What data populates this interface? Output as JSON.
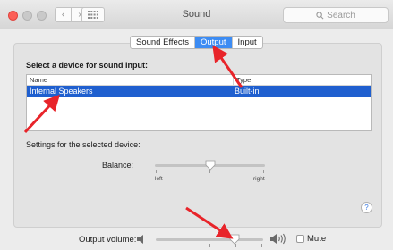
{
  "window": {
    "title": "Sound"
  },
  "toolbar": {
    "back_icon": "chevron-left-icon",
    "forward_icon": "chevron-right-icon",
    "grid_icon": "grid-icon",
    "search_placeholder": "Search",
    "search_icon": "search-icon"
  },
  "tabs": [
    {
      "label": "Sound Effects",
      "active": false
    },
    {
      "label": "Output",
      "active": true
    },
    {
      "label": "Input",
      "active": false
    }
  ],
  "device_section": {
    "title": "Select a device for sound input:",
    "columns": [
      "Name",
      "Type"
    ],
    "rows": [
      {
        "name": "Internal Speakers",
        "type": "Built-in",
        "selected": true
      }
    ]
  },
  "settings": {
    "title": "Settings for the selected device:",
    "balance_label": "Balance:",
    "balance_left": "left",
    "balance_right": "right",
    "balance_value": 0.5
  },
  "help": {
    "label": "?"
  },
  "volume": {
    "label": "Output volume:",
    "value": 0.73,
    "mute_label": "Mute",
    "muted": false
  },
  "colors": {
    "accent": "#3d8cf3",
    "selection": "#1f5fcf",
    "annotation_arrow": "#e8242a"
  }
}
